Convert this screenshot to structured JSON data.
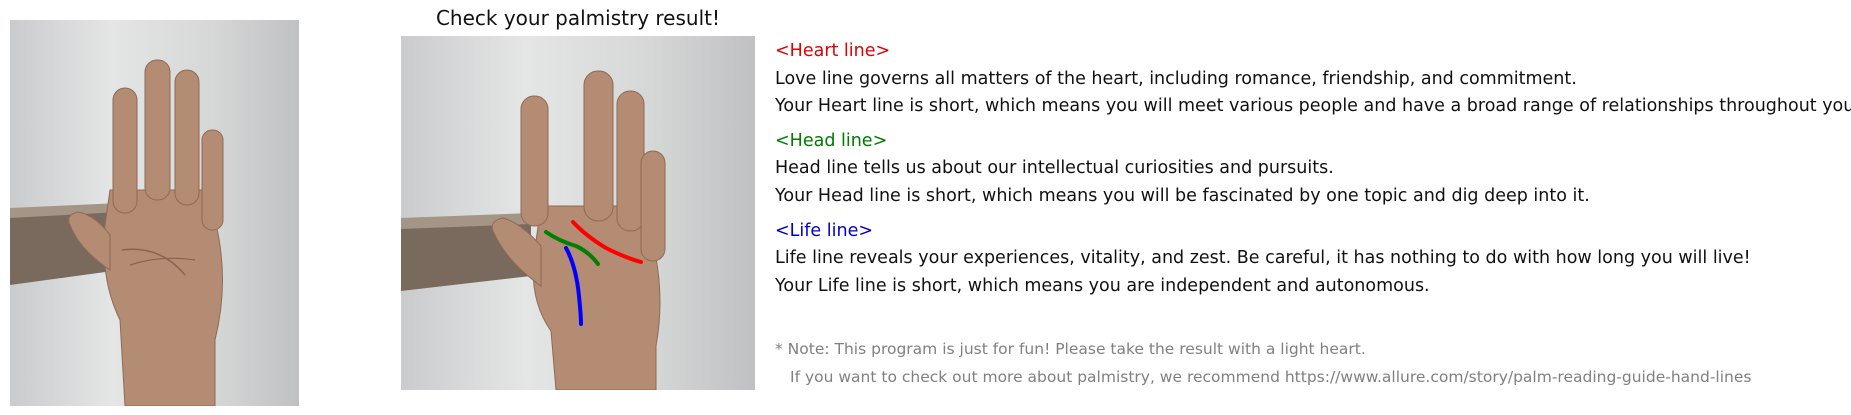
{
  "title": "Check your palmistry result!",
  "sections": [
    {
      "header": "<Heart line>",
      "color": "#e00000",
      "desc": "Love line governs all matters of the heart, including romance, friendship, and commitment.",
      "result": "Your Heart line is short, which means you will meet various people and have a broad range of relationships throughout your life."
    },
    {
      "header": "<Head line>",
      "color": "#007a00",
      "desc": "Head line tells us about our intellectual curiosities and pursuits.",
      "result": "Your Head line is short, which means you will be fascinated by one topic and dig deep into it."
    },
    {
      "header": "<Life line>",
      "color": "#0000cc",
      "desc": "Life line reveals your experiences, vitality, and zest. Be careful, it has nothing to do with how long you will live!",
      "result": "Your Life line is short, which means you are independent and autonomous."
    }
  ],
  "note": {
    "line1": "* Note: This program is just for fun! Please take the result with a light heart.",
    "line2": "If you want to check out more about palmistry, we recommend https://www.allure.com/story/palm-reading-guide-hand-lines"
  },
  "line_colors": {
    "heart": "#ff0000",
    "head": "#008000",
    "life": "#0000ff"
  }
}
